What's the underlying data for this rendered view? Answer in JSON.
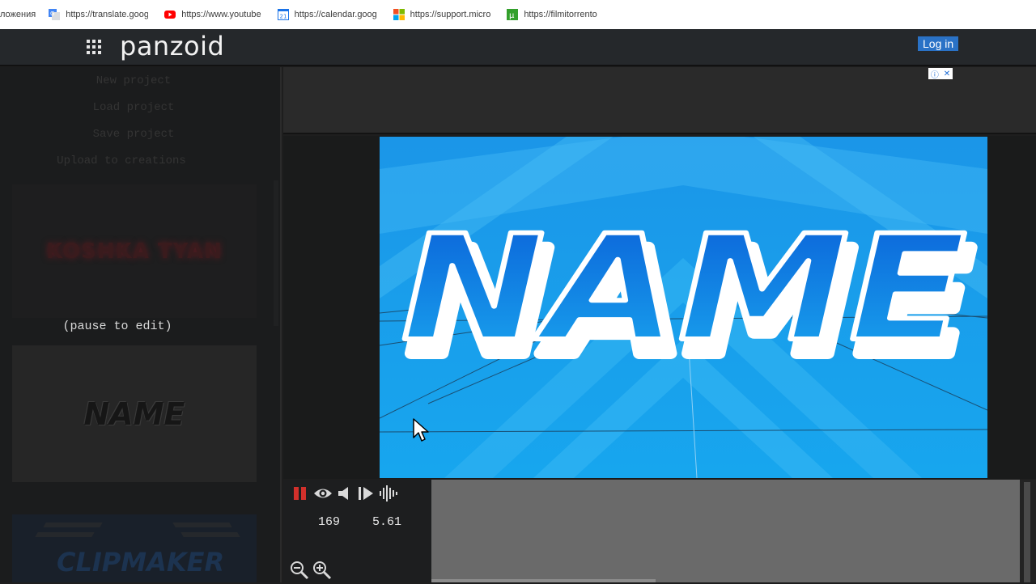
{
  "bookmarks": {
    "first_partial": "ложения",
    "items": [
      {
        "label": "https://translate.goog",
        "icon": "google-translate-icon"
      },
      {
        "label": "https://www.youtube",
        "icon": "youtube-icon"
      },
      {
        "label": "https://calendar.goog",
        "icon": "calendar-icon",
        "icon_text": "21"
      },
      {
        "label": "https://support.micro",
        "icon": "microsoft-icon"
      },
      {
        "label": "https://filmitorrento",
        "icon": "torrent-icon"
      }
    ]
  },
  "nav": {
    "logo": "panzoid",
    "login": "Log in",
    "accent": "#2a72c6"
  },
  "sidebar": {
    "menu": [
      "New project",
      "Load project",
      "Save project",
      "Upload to creations"
    ],
    "thumb1_text": "KOSHKA TYAN",
    "pause_note": "(pause to edit)",
    "thumb2_text": "NAME",
    "thumb3_text": "CLIPMAKER"
  },
  "stage": {
    "title_text": "NAME",
    "bg_color": "#1da3ec"
  },
  "controls": {
    "frame": "169",
    "time": "5.61"
  }
}
